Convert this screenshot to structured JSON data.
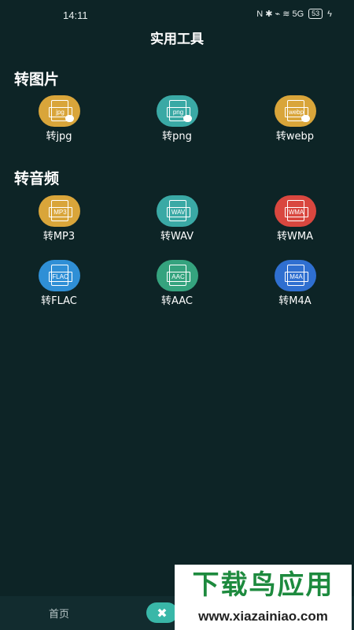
{
  "status_bar": {
    "time": "14:11",
    "indicators": "N  ✱  ⌁  ≋  5G",
    "battery": "53",
    "charging": "ϟ"
  },
  "header": {
    "title": "实用工具"
  },
  "sections": {
    "image": {
      "title": "转图片",
      "tools": [
        {
          "label": "转jpg",
          "icon_text": "jpg",
          "icon": "jpg-file-icon",
          "color": "#d9a53a"
        },
        {
          "label": "转png",
          "icon_text": "png",
          "icon": "png-file-icon",
          "color": "#3aa9a5"
        },
        {
          "label": "转webp",
          "icon_text": "webp",
          "icon": "webp-file-icon",
          "color": "#d9a53a"
        }
      ]
    },
    "audio": {
      "title": "转音频",
      "tools": [
        {
          "label": "转MP3",
          "icon_text": "MP3",
          "icon": "mp3-file-icon",
          "color": "#d9a53a"
        },
        {
          "label": "转WAV",
          "icon_text": "WAV",
          "icon": "wav-file-icon",
          "color": "#3aa9a5"
        },
        {
          "label": "转WMA",
          "icon_text": "WMA",
          "icon": "wma-file-icon",
          "color": "#d9473f"
        },
        {
          "label": "转FLAC",
          "icon_text": "FLAC",
          "icon": "flac-file-icon",
          "color": "#2f8fd6"
        },
        {
          "label": "转AAC",
          "icon_text": "AAC",
          "icon": "aac-file-icon",
          "color": "#35a37e"
        },
        {
          "label": "转M4A",
          "icon_text": "M4A",
          "icon": "m4a-file-icon",
          "color": "#2f6fd0"
        }
      ]
    }
  },
  "bottom_nav": {
    "home_label": "首页",
    "tools_icon": "tools-icon"
  },
  "watermark": {
    "title": "下载鸟应用",
    "url": "www.xiazainiao.com"
  }
}
